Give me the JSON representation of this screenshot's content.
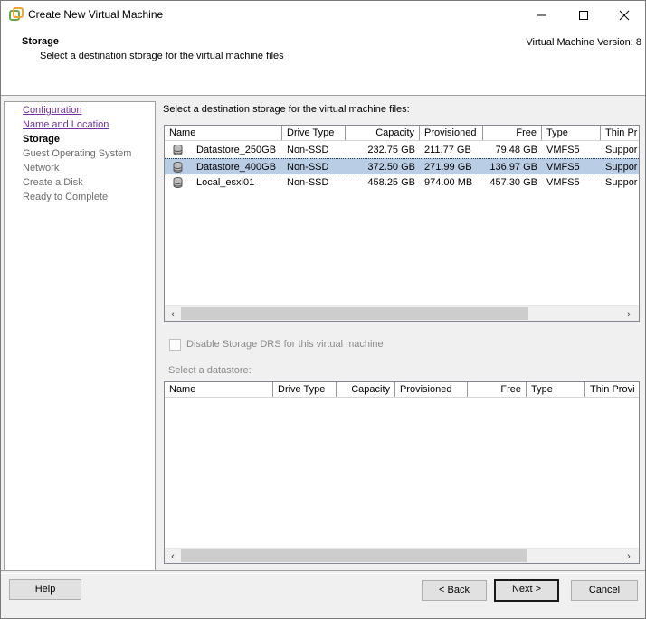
{
  "window": {
    "title": "Create New Virtual Machine"
  },
  "header": {
    "title": "Storage",
    "subtitle": "Select a destination storage for the virtual machine files",
    "version": "Virtual Machine Version: 8"
  },
  "nav": {
    "items": [
      {
        "label": "Configuration",
        "state": "link"
      },
      {
        "label": "Name and Location",
        "state": "link"
      },
      {
        "label": "Storage",
        "state": "current"
      },
      {
        "label": "Guest Operating System",
        "state": "pending"
      },
      {
        "label": "Network",
        "state": "pending"
      },
      {
        "label": "Create a Disk",
        "state": "pending"
      },
      {
        "label": "Ready to Complete",
        "state": "pending"
      }
    ]
  },
  "main": {
    "label": "Select a destination storage for the virtual machine files:",
    "columns": [
      "Name",
      "Drive Type",
      "Capacity",
      "Provisioned",
      "Free",
      "Type",
      "Thin Pr"
    ],
    "rows": [
      {
        "name": "Datastore_250GB",
        "drive_type": "Non-SSD",
        "capacity": "232.75 GB",
        "provisioned": "211.77 GB",
        "free": "79.48 GB",
        "type": "VMFS5",
        "thin": "Suppor"
      },
      {
        "name": "Datastore_400GB",
        "drive_type": "Non-SSD",
        "capacity": "372.50 GB",
        "provisioned": "271.99 GB",
        "free": "136.97 GB",
        "type": "VMFS5",
        "thin": "Suppor"
      },
      {
        "name": "Local_esxi01",
        "drive_type": "Non-SSD",
        "capacity": "458.25 GB",
        "provisioned": "974.00 MB",
        "free": "457.30 GB",
        "type": "VMFS5",
        "thin": "Suppor"
      }
    ],
    "selected_row": 1,
    "disable_drs_label": "Disable Storage DRS for this virtual machine",
    "select_datastore_label": "Select a datastore:",
    "columns2": [
      "Name",
      "Drive Type",
      "Capacity",
      "Provisioned",
      "Free",
      "Type",
      "Thin Provi"
    ]
  },
  "buttons": {
    "help": "Help",
    "back": "< Back",
    "next": "Next >",
    "cancel": "Cancel"
  },
  "colors": {
    "selection": "#b9cde5",
    "link": "#7030a0",
    "disabled": "#8a8a8a"
  }
}
